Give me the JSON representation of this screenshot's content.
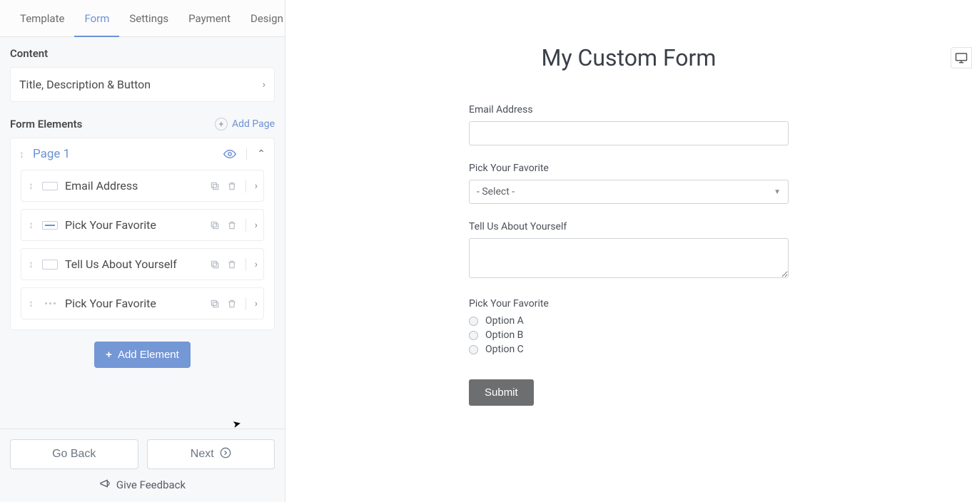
{
  "tabs": {
    "template": "Template",
    "form": "Form",
    "settings": "Settings",
    "payment": "Payment",
    "design": "Design"
  },
  "sidebar": {
    "content_label": "Content",
    "content_row": "Title, Description & Button",
    "form_elements_label": "Form Elements",
    "add_page_label": "Add Page",
    "page_1_label": "Page 1",
    "elements": [
      {
        "label": "Email Address"
      },
      {
        "label": "Pick Your Favorite"
      },
      {
        "label": "Tell Us About Yourself"
      },
      {
        "label": "Pick Your Favorite"
      }
    ],
    "add_element_label": "Add Element"
  },
  "footer": {
    "go_back": "Go Back",
    "next": "Next",
    "feedback": "Give Feedback"
  },
  "preview": {
    "title": "My Custom Form",
    "fields": {
      "email": {
        "label": "Email Address",
        "value": ""
      },
      "favorite_select": {
        "label": "Pick Your Favorite",
        "placeholder": "- Select -"
      },
      "about": {
        "label": "Tell Us About Yourself",
        "value": ""
      },
      "favorite_radio": {
        "label": "Pick Your Favorite",
        "options": [
          "Option A",
          "Option B",
          "Option C"
        ]
      }
    },
    "submit": "Submit"
  }
}
